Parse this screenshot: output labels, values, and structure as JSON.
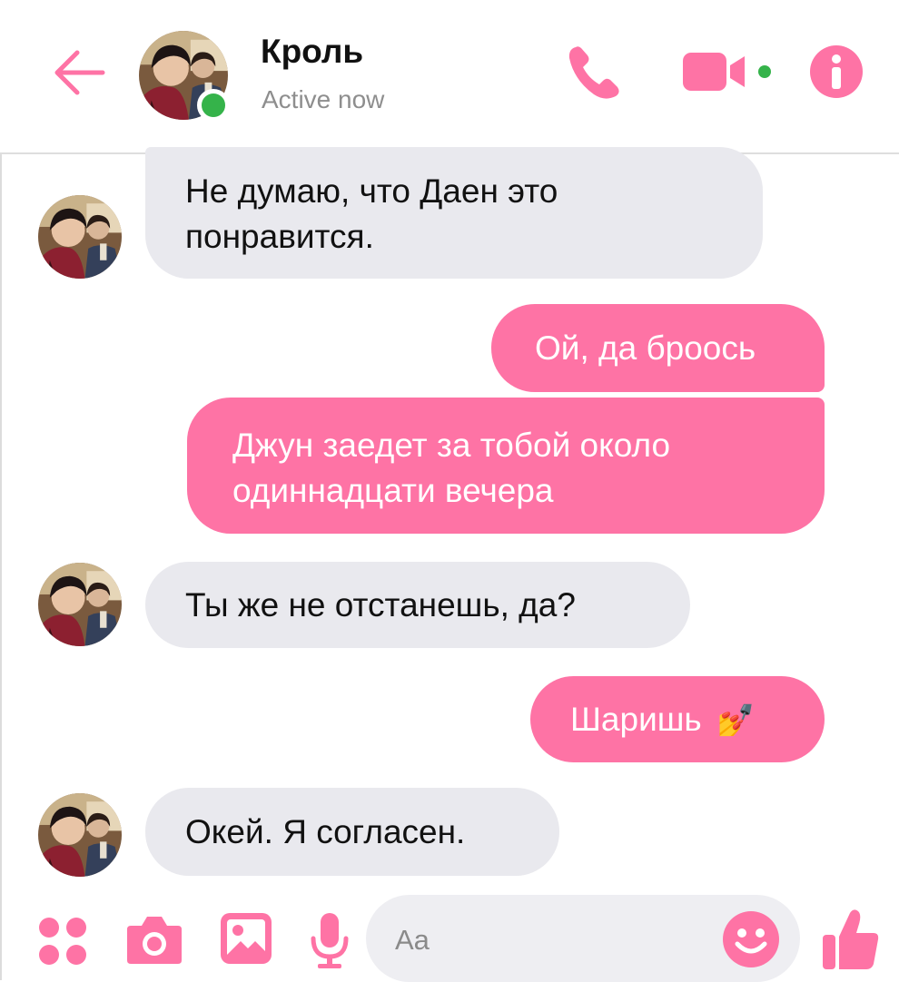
{
  "header": {
    "contact_name": "Кроль",
    "status": "Active now"
  },
  "messages": [
    {
      "direction": "incoming",
      "line1": "Не думаю, что Даен это",
      "line2": "понравится."
    },
    {
      "direction": "outgoing",
      "text": "Ой, да броось"
    },
    {
      "direction": "outgoing",
      "line1": "Джун заедет за тобой около",
      "line2": "одиннадцати вечера"
    },
    {
      "direction": "incoming",
      "text": "Ты же не отстанешь, да?"
    },
    {
      "direction": "outgoing",
      "text": "Шаришь",
      "emoji": "💅"
    },
    {
      "direction": "incoming",
      "text": "Окей. Я согласен."
    }
  ],
  "composer": {
    "placeholder": "Aa"
  },
  "icons": {
    "back": "back-arrow-icon",
    "call": "phone-icon",
    "video": "video-camera-icon",
    "info": "info-icon",
    "menu": "four-dots-icon",
    "camera": "camera-icon",
    "gallery": "image-icon",
    "mic": "microphone-icon",
    "emoji": "smiley-icon",
    "like": "thumbs-up-icon"
  },
  "colors": {
    "accent": "#fe73a5",
    "incoming_bubble": "#e9e9ee",
    "online": "#35b34a"
  }
}
